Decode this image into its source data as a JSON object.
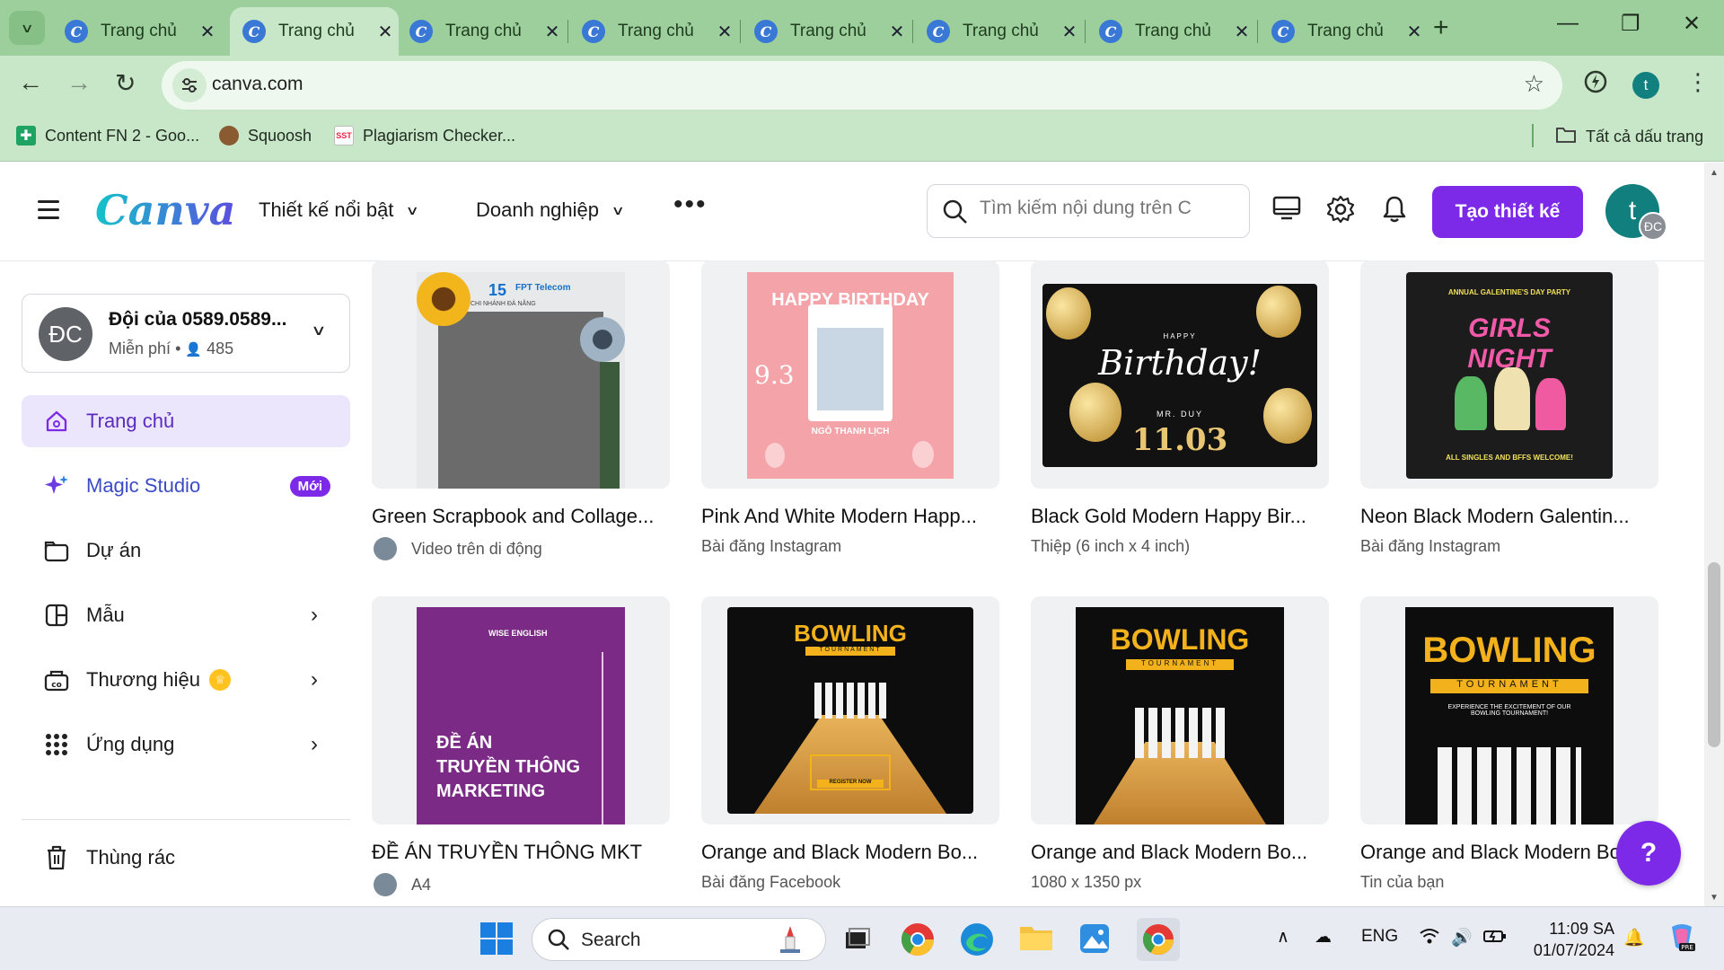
{
  "browser": {
    "tabs": [
      {
        "label": "Trang chủ"
      },
      {
        "label": "Trang chủ"
      },
      {
        "label": "Trang chủ"
      },
      {
        "label": "Trang chủ"
      },
      {
        "label": "Trang chủ"
      },
      {
        "label": "Trang chủ"
      },
      {
        "label": "Trang chủ"
      },
      {
        "label": "Trang chủ"
      }
    ],
    "active_tab_index": 1,
    "url": "canva.com",
    "profile_initial": "t",
    "bookmarks": [
      {
        "label": "Content FN 2 - Goo...",
        "icon": "sheets-icon"
      },
      {
        "label": "Squoosh",
        "icon": "squoosh-icon"
      },
      {
        "label": "Plagiarism Checker...",
        "icon": "sst-icon",
        "icon_text": "SST"
      }
    ],
    "all_bookmarks_label": "Tất cả dấu trang"
  },
  "header": {
    "logo": "Canva",
    "nav": [
      {
        "label": "Thiết kế nổi bật"
      },
      {
        "label": "Doanh nghiệp"
      }
    ],
    "search_placeholder": "Tìm kiếm nội dung trên C",
    "create_button": "Tạo thiết kế",
    "avatar_initial": "t",
    "team_avatar_initials": "ĐC"
  },
  "sidebar": {
    "team": {
      "initials": "ĐC",
      "name": "Đội của 0589.0589...",
      "plan": "Miễn phí",
      "members": "485"
    },
    "items": [
      {
        "label": "Trang chủ",
        "icon": "home-icon",
        "active": true
      },
      {
        "label": "Magic Studio",
        "icon": "sparkle-icon",
        "badge": "Mới"
      },
      {
        "label": "Dự án",
        "icon": "folder-icon"
      },
      {
        "label": "Mẫu",
        "icon": "template-icon",
        "arrow": true
      },
      {
        "label": "Thương hiệu",
        "icon": "brand-icon",
        "arrow": true,
        "crown": true
      },
      {
        "label": "Ứng dụng",
        "icon": "apps-grid-icon",
        "arrow": true
      }
    ],
    "trash": "Thùng rác"
  },
  "designs": [
    {
      "title": "Green Scrapbook and Collage...",
      "subtitle": "Video trên di động",
      "has_avatar": true,
      "art": {
        "badge": "15",
        "brand": "FPT Telecom",
        "caption": "CHI NHÁNH ĐÀ NẴNG"
      }
    },
    {
      "title": "Pink And White Modern Happ...",
      "subtitle": "Bài đăng Instagram",
      "art": {
        "headline": "HAPPY BIRTHDAY",
        "date": "9.3",
        "name": "NGÔ THANH LỊCH"
      }
    },
    {
      "title": "Black Gold Modern Happy Bir...",
      "subtitle": "Thiệp (6 inch x 4 inch)",
      "art": {
        "top": "HAPPY",
        "script": "Birthday!",
        "name": "MR. DUY",
        "date": "11.03"
      }
    },
    {
      "title": "Neon Black Modern Galentin...",
      "subtitle": "Bài đăng Instagram",
      "art": {
        "top": "ANNUAL GALENTINE'S DAY PARTY",
        "headline": "GIRLS NIGHT",
        "bottom": "ALL SINGLES AND BFFS WELCOME!"
      }
    },
    {
      "title": "ĐỀ ÁN TRUYỀN THÔNG MKT",
      "subtitle": "A4",
      "has_avatar": true,
      "art": {
        "brand": "WISE ENGLISH",
        "line1": "ĐỀ ÁN",
        "line2": "TRUYỀN THÔNG",
        "line3": "MARKETING"
      }
    },
    {
      "title": "Orange and Black Modern Bo...",
      "subtitle": "Bài đăng Facebook",
      "art": {
        "headline": "BOWLING",
        "sub": "TOURNAMENT",
        "cta": "REGISTER NOW"
      }
    },
    {
      "title": "Orange and Black Modern Bo...",
      "subtitle": "1080 x 1350 px",
      "art": {
        "headline": "BOWLING",
        "sub": "TOURNAMENT"
      }
    },
    {
      "title": "Orange and Black Modern Bo...",
      "subtitle": "Tin của bạn",
      "art": {
        "headline": "BOWLING",
        "sub": "TOURNAMENT",
        "tag": "EXPERIENCE THE EXCITEMENT OF OUR BOWLING TOURNAMENT!"
      }
    }
  ],
  "help_button": "?",
  "taskbar": {
    "search_label": "Search",
    "lang": "ENG",
    "time": "11:09 SA",
    "date": "01/07/2024"
  },
  "colors": {
    "canva_purple": "#7d2ae8",
    "chrome_green": "#c8e6c8",
    "tab_strip_green": "#9ccf9c"
  }
}
